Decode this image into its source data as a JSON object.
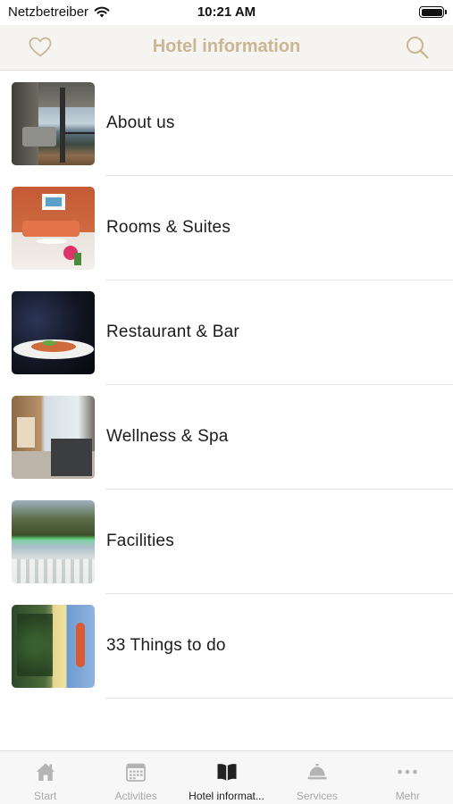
{
  "status_bar": {
    "carrier": "Netzbetreiber",
    "time": "10:21 AM"
  },
  "nav": {
    "title": "Hotel information",
    "left_icon": "heart-icon",
    "right_icon": "search-icon"
  },
  "list": {
    "items": [
      {
        "label": "About us",
        "image": "hotel-balcony-lake-view"
      },
      {
        "label": "Rooms & Suites",
        "image": "orange-living-room"
      },
      {
        "label": "Restaurant & Bar",
        "image": "plated-dish"
      },
      {
        "label": "Wellness & Spa",
        "image": "spa-relaxation-room"
      },
      {
        "label": "Facilities",
        "image": "lakeside-mountains"
      },
      {
        "label": "33 Things to do",
        "image": "climbing-wall"
      }
    ]
  },
  "tab_bar": {
    "tabs": [
      {
        "label": "Start",
        "icon": "home-icon",
        "active": false
      },
      {
        "label": "Activities",
        "icon": "calendar-icon",
        "active": false
      },
      {
        "label": "Hotel informat...",
        "icon": "book-icon",
        "active": true
      },
      {
        "label": "Services",
        "icon": "service-bell-icon",
        "active": false
      },
      {
        "label": "Mehr",
        "icon": "more-dots-icon",
        "active": false
      }
    ]
  },
  "colors": {
    "accent": "#c9b693",
    "nav_background": "#f6f4f1",
    "tab_active": "#222222",
    "tab_inactive": "#a9a9a9"
  }
}
